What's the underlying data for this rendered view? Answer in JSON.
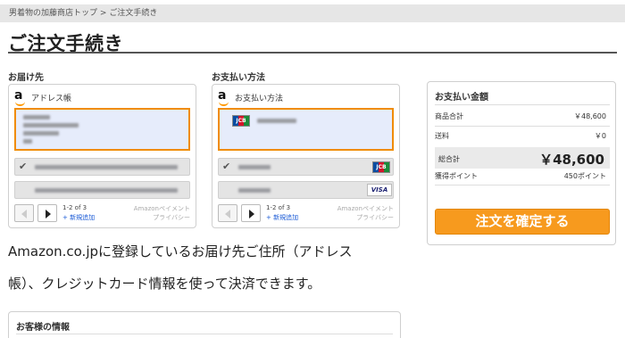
{
  "breadcrumb": {
    "home": "男着物の加藤商店トップ",
    "sep": ">",
    "current": "ご注文手続き"
  },
  "page_title": "ご注文手続き",
  "shipping": {
    "label": "お届け先",
    "widget_title": "アドレス帳",
    "page_count": "1-2 of 3",
    "new_link": "+ 新規追加",
    "amazon_pay": "Amazonペイメント",
    "privacy": "プライバシー"
  },
  "payment": {
    "label": "お支払い方法",
    "widget_title": "お支払い方法",
    "page_count": "1-2 of 3",
    "new_link": "+ 新規追加",
    "amazon_pay": "Amazonペイメント",
    "privacy": "プライバシー",
    "card1_brand": "JCB",
    "card2_brand": "JCB",
    "card3_brand": "VISA"
  },
  "description": {
    "line1": "Amazon.co.jpに登録しているお届け先ご住所（アドレス",
    "line2": "帳）、クレジットカード情報を使って決済できます。"
  },
  "summary": {
    "title": "お支払い金額",
    "subtotal_label": "商品合計",
    "subtotal_value": "￥48,600",
    "shipping_label": "送料",
    "shipping_value": "￥0",
    "total_label": "総合計",
    "total_value": "￥48,600",
    "points_label": "獲得ポイント",
    "points_value": "450ポイント",
    "confirm_button": "注文を確定する"
  },
  "customer": {
    "title": "お客様の情報"
  },
  "colors": {
    "accent_orange": "#f79a1e",
    "selected_border": "#f08c00",
    "link_blue": "#1a5ad6"
  }
}
